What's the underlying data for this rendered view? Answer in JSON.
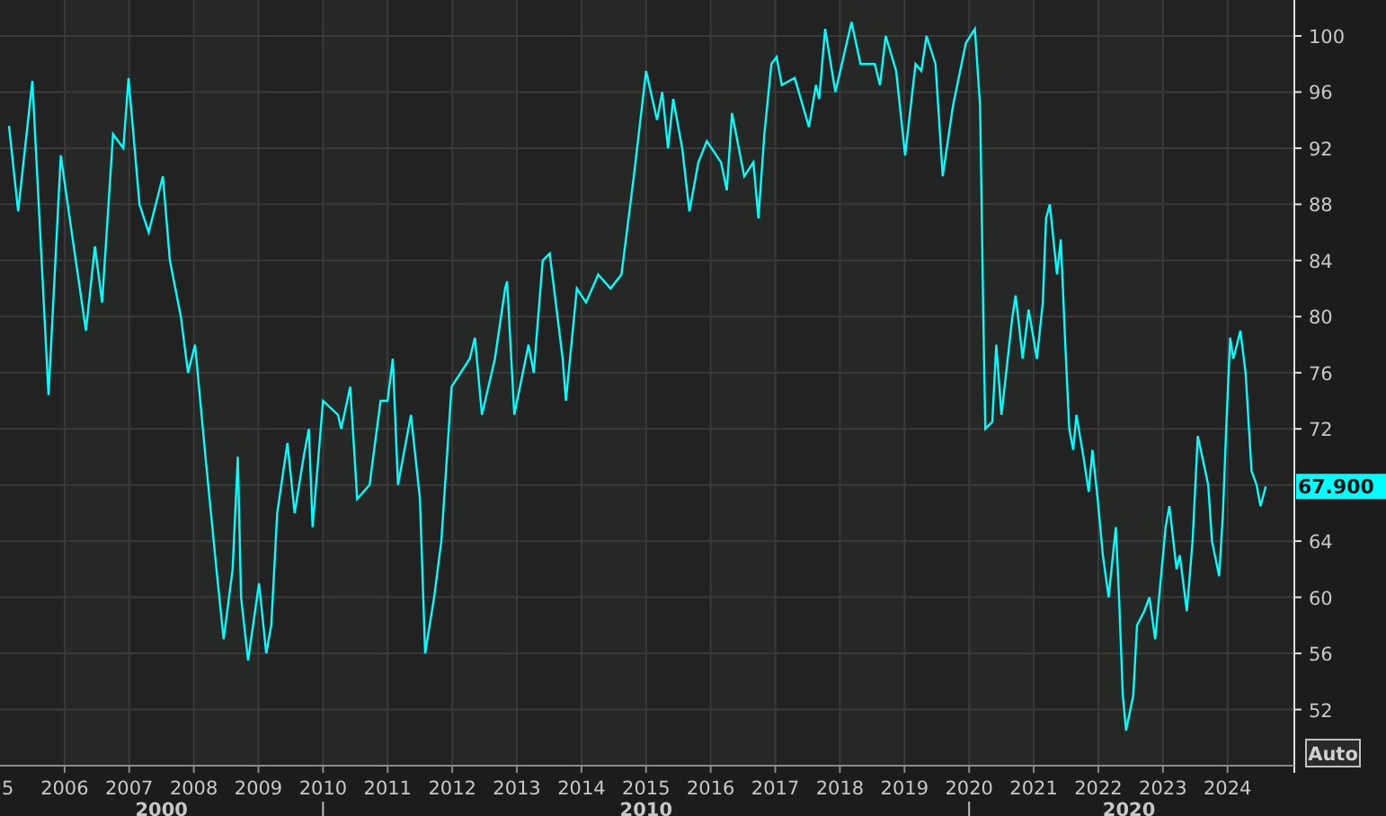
{
  "chart": {
    "chart_data": {
      "type": "line",
      "x": [
        2005.14,
        2005.28,
        2005.5,
        2005.75,
        2005.94,
        2006.11,
        2006.33,
        2006.47,
        2006.58,
        2006.75,
        2006.91,
        2006.99,
        2007.16,
        2007.3,
        2007.52,
        2007.63,
        2007.8,
        2007.91,
        2008.02,
        2008.18,
        2008.35,
        2008.46,
        2008.6,
        2008.68,
        2008.73,
        2008.84,
        2009.01,
        2009.12,
        2009.2,
        2009.29,
        2009.45,
        2009.56,
        2009.7,
        2009.78,
        2009.84,
        2010.0,
        2010.23,
        2010.28,
        2010.42,
        2010.53,
        2010.72,
        2010.89,
        2011.0,
        2011.08,
        2011.16,
        2011.36,
        2011.5,
        2011.58,
        2011.72,
        2011.83,
        2011.99,
        2012.27,
        2012.35,
        2012.46,
        2012.66,
        2012.82,
        2012.85,
        2012.96,
        2013.18,
        2013.26,
        2013.4,
        2013.51,
        2013.71,
        2013.76,
        2013.93,
        2014.07,
        2014.26,
        2014.45,
        2014.62,
        2014.81,
        2015.0,
        2015.17,
        2015.25,
        2015.34,
        2015.42,
        2015.56,
        2015.67,
        2015.81,
        2015.94,
        2016.16,
        2016.25,
        2016.33,
        2016.52,
        2016.66,
        2016.74,
        2016.83,
        2016.94,
        2017.02,
        2017.1,
        2017.3,
        2017.52,
        2017.63,
        2017.68,
        2017.77,
        2017.93,
        2018.18,
        2018.32,
        2018.54,
        2018.62,
        2018.71,
        2018.87,
        2019.01,
        2019.17,
        2019.26,
        2019.34,
        2019.48,
        2019.59,
        2019.75,
        2019.95,
        2020.09,
        2020.17,
        2020.22,
        2020.25,
        2020.36,
        2020.42,
        2020.5,
        2020.67,
        2020.72,
        2020.83,
        2020.92,
        2021.05,
        2021.14,
        2021.19,
        2021.25,
        2021.36,
        2021.42,
        2021.49,
        2021.55,
        2021.61,
        2021.66,
        2021.77,
        2021.85,
        2021.91,
        2021.99,
        2022.07,
        2022.16,
        2022.27,
        2022.32,
        2022.38,
        2022.43,
        2022.54,
        2022.6,
        2022.71,
        2022.79,
        2022.88,
        2022.96,
        2023.04,
        2023.1,
        2023.21,
        2023.26,
        2023.37,
        2023.46,
        2023.54,
        2023.7,
        2023.76,
        2023.87,
        2023.93,
        2023.98,
        2024.04,
        2024.09,
        2024.2,
        2024.28,
        2024.37,
        2024.45,
        2024.51,
        2024.59
      ],
      "series": [
        {
          "color": "#00ffff",
          "values": [
            93.6,
            87.5,
            96.8,
            74.4,
            91.5,
            86,
            79,
            85,
            81,
            93,
            92,
            97,
            88,
            86,
            90,
            84,
            80,
            76,
            78,
            70,
            62,
            57,
            62,
            70,
            60,
            55.5,
            61,
            56,
            58,
            66,
            71,
            66,
            70,
            72,
            65,
            74,
            73,
            72,
            75,
            67,
            68,
            74,
            74,
            77,
            68,
            73,
            67,
            56,
            60,
            64,
            75,
            77,
            78.5,
            73,
            77,
            82,
            82.5,
            73,
            78,
            76,
            84,
            84.5,
            77,
            74,
            82,
            81,
            83,
            82,
            83,
            90,
            97.5,
            94,
            96,
            92,
            95.5,
            92,
            87.5,
            91,
            92.5,
            91,
            89,
            94.5,
            90,
            91,
            87,
            93,
            98,
            98.5,
            96.5,
            97,
            93.5,
            96.5,
            95.5,
            100.5,
            96,
            101,
            98,
            98,
            96.5,
            100,
            97.5,
            91.5,
            98,
            97.5,
            100,
            98,
            90,
            95,
            99.5,
            100.5,
            95,
            80,
            72,
            72.5,
            78,
            73,
            80,
            81.5,
            77,
            80.5,
            77,
            81,
            87,
            88,
            83,
            85.5,
            78,
            72,
            70.5,
            73,
            70,
            67.5,
            70.5,
            67,
            63,
            60,
            65,
            60,
            53,
            50.5,
            53,
            58,
            59,
            60,
            57,
            61,
            65,
            66.5,
            62,
            63,
            59,
            64,
            71.5,
            68,
            64,
            61.5,
            66,
            72,
            78.5,
            77,
            79,
            76,
            69,
            68,
            66.5,
            67.9
          ]
        }
      ],
      "xlim": [
        2005,
        2024.95
      ],
      "ylim": [
        48,
        102.56
      ],
      "grid": true,
      "xticks": [
        2006,
        2007,
        2008,
        2009,
        2010,
        2011,
        2012,
        2013,
        2014,
        2015,
        2016,
        2017,
        2018,
        2019,
        2020,
        2021,
        2022,
        2023,
        2024
      ],
      "yticks": [
        52,
        56,
        60,
        64,
        72,
        76,
        80,
        84,
        88,
        92,
        96,
        100
      ]
    },
    "current_value": {
      "label": "67.900"
    },
    "cut_x_label": "5",
    "decades": [
      {
        "label": "2000"
      },
      {
        "label": "2010"
      },
      {
        "label": "2020"
      }
    ],
    "auto_button": {
      "label": "Auto"
    }
  }
}
